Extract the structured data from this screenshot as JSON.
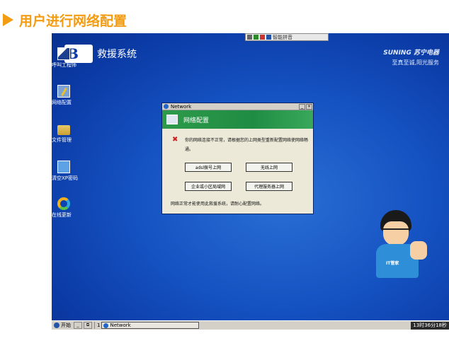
{
  "heading": {
    "title": "用户进行网络配置",
    "accent_color": "#f39c12"
  },
  "ime_bar": {
    "label": "智能拼音"
  },
  "brand": {
    "title": "救援系统",
    "logo": "B",
    "right_line1": "SUNING 苏宁电器",
    "right_line2": "至真至诚,阳光服务"
  },
  "desktop_icons": [
    {
      "label": "呼叫工程师",
      "icon": "engineer-icon"
    },
    {
      "label": "网络配置",
      "icon": "network-config-icon"
    },
    {
      "label": "文件管理",
      "icon": "folder-icon"
    },
    {
      "label": "清空XP密码",
      "icon": "password-icon"
    },
    {
      "label": "在线更新",
      "icon": "update-icon"
    }
  ],
  "window": {
    "title": "Network",
    "header": "网络配置",
    "message": "你的网络连接不正常，请根据您的上网类型重新配置网络使网络畅通。",
    "buttons": {
      "adsl": "adsl拨号上网",
      "wireless": "无线上网",
      "lan": "企业或小区局域网",
      "proxy": "代理服务器上网"
    },
    "footer": "网络正常才能使用此救援系统，请耐心配置网络。",
    "minimize": "_",
    "close": "×"
  },
  "mascot": {
    "badge": "IT管家"
  },
  "taskbar": {
    "start": "开始",
    "quick1": "_",
    "quick2": "⧉",
    "count": "1",
    "task": "Network",
    "clock": "13时36分18秒"
  }
}
